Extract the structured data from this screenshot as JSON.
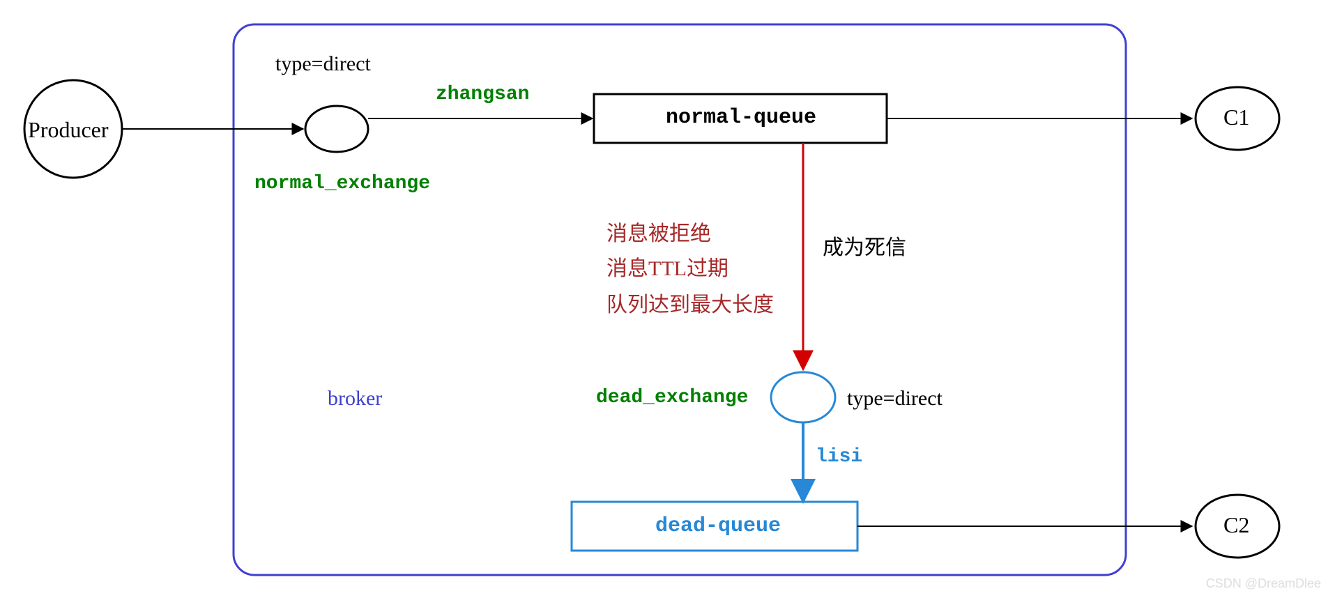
{
  "producer": "Producer",
  "normalExchange": {
    "typeLabel": "type=direct",
    "name": "normal_exchange",
    "routingKey": "zhangsan"
  },
  "normalQueue": "normal-queue",
  "consumer1": "C1",
  "deadReasons": {
    "line1": "消息被拒绝",
    "line2": "消息TTL过期",
    "line3": "队列达到最大长度",
    "becomes": "成为死信"
  },
  "deadExchange": {
    "name": "dead_exchange",
    "typeLabel": "type=direct",
    "routingKey": "lisi"
  },
  "deadQueue": "dead-queue",
  "consumer2": "C2",
  "brokerLabel": "broker",
  "watermark": "CSDN @DreamDlee"
}
